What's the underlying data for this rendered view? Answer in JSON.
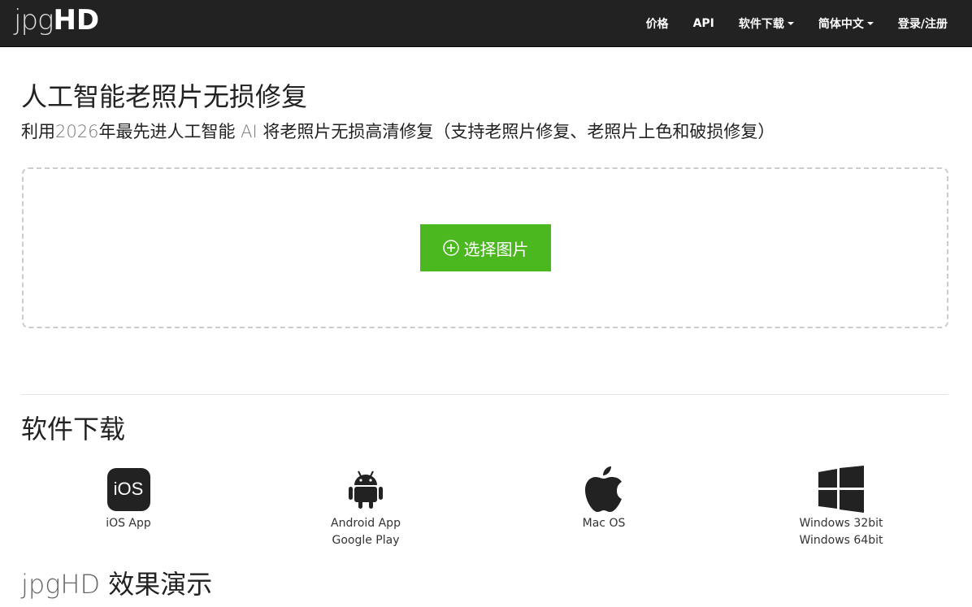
{
  "brand": {
    "thin": "jpg",
    "bold": "HD"
  },
  "nav": {
    "pricing": "价格",
    "api": "API",
    "downloads": "软件下载",
    "language": "简体中文",
    "login": "登录/注册"
  },
  "hero": {
    "title": "人工智能老照片无损修复",
    "lead_a": "利用",
    "lead_year": "2026",
    "lead_b": "年最先进人工智能 ",
    "lead_ai": "AI",
    "lead_c": " 将老照片无损高清修复（支持老照片修复、老照片上色和破损修复）"
  },
  "upload": {
    "button_label": "选择图片"
  },
  "downloads": {
    "heading": "软件下载",
    "ios_badge": "iOS",
    "ios_label": "iOS App",
    "android_line1": "Android App",
    "android_line2": "Google Play",
    "mac_label": "Mac OS",
    "win_line1": "Windows 32bit",
    "win_line2": "Windows 64bit"
  },
  "demo": {
    "heading_a": "jpgHD",
    "heading_b": " 效果演示"
  },
  "icons": [
    "plus-circle-icon",
    "ios-icon",
    "android-icon",
    "apple-icon",
    "windows-icon"
  ],
  "colors": {
    "navbar": "#222222",
    "accent": "#4cb81f"
  }
}
